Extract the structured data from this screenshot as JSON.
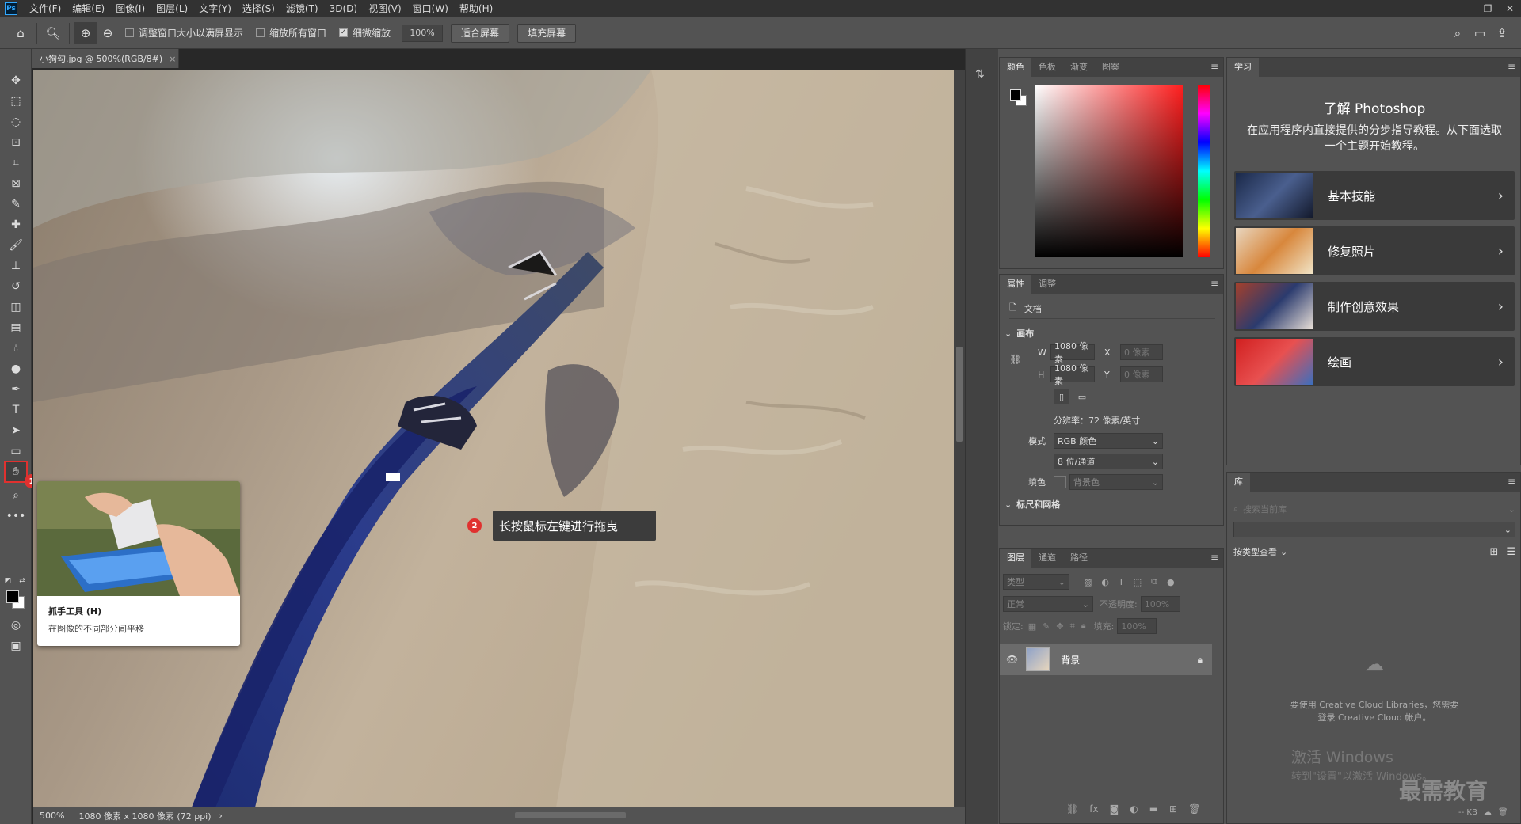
{
  "menubar": {
    "logo": "Ps",
    "items": [
      "文件(F)",
      "编辑(E)",
      "图像(I)",
      "图层(L)",
      "文字(Y)",
      "选择(S)",
      "滤镜(T)",
      "3D(D)",
      "视图(V)",
      "窗口(W)",
      "帮助(H)"
    ],
    "window_buttons": [
      "—",
      "❐",
      "✕"
    ]
  },
  "options": {
    "resize_windows": "调整窗口大小以满屏显示",
    "zoom_all": "缩放所有窗口",
    "scrubby_zoom": "细微缩放",
    "zoom_value": "100%",
    "fit_screen": "适合屏幕",
    "fill_screen": "填充屏幕"
  },
  "document": {
    "tab_title": "小狗勾.jpg @ 500%(RGB/8#)",
    "close": "×",
    "status_zoom": "500%",
    "status_info": "1080 像素 x 1080 像素 (72 ppi)"
  },
  "tooltip": {
    "title": "抓手工具 (H)",
    "desc": "在图像的不同部分间平移"
  },
  "badges": {
    "one": "1",
    "two": "2"
  },
  "callout": "长按鼠标左键进行拖曳",
  "color_panel": {
    "tabs": [
      "颜色",
      "色板",
      "渐变",
      "图案"
    ]
  },
  "properties_panel": {
    "tabs": [
      "属性",
      "调整"
    ],
    "doc_label": "文档",
    "canvas_label": "画布",
    "w_label": "W",
    "w_value": "1080 像素",
    "h_label": "H",
    "h_value": "1080 像素",
    "x_label": "X",
    "x_value": "0 像素",
    "y_label": "Y",
    "y_value": "0 像素",
    "resolution": "分辨率：72 像素/英寸",
    "mode_label": "模式",
    "mode_value": "RGB 颜色",
    "depth_value": "8 位/通道",
    "fill_label": "填色",
    "fill_value": "背景色",
    "cut_section": "标尺和网格"
  },
  "layers_panel": {
    "tabs": [
      "图层",
      "通道",
      "路径"
    ],
    "filter_placeholder": "类型",
    "blend_mode": "正常",
    "opacity_label": "不透明度:",
    "opacity_value": "100%",
    "lock_label": "锁定:",
    "fill_label": "填充:",
    "fill_value": "100%",
    "layer_name": "背景"
  },
  "learn_panel": {
    "tab": "学习",
    "title": "了解 Photoshop",
    "desc": "在应用程序内直接提供的分步指导教程。从下面选取一个主题开始教程。",
    "cards": [
      "基本技能",
      "修复照片",
      "制作创意效果",
      "绘画"
    ]
  },
  "library_panel": {
    "tab": "库",
    "search_placeholder": "搜索当前库",
    "view_by": "按类型查看",
    "signin": "要使用 Creative Cloud Libraries，您需要登录 Creative Cloud 帐户。",
    "kb": "-- KB"
  },
  "watermark": {
    "activate": "激活 Windows",
    "activate_sub": "转到\"设置\"以激活 Windows。",
    "brand": "最需教育"
  }
}
